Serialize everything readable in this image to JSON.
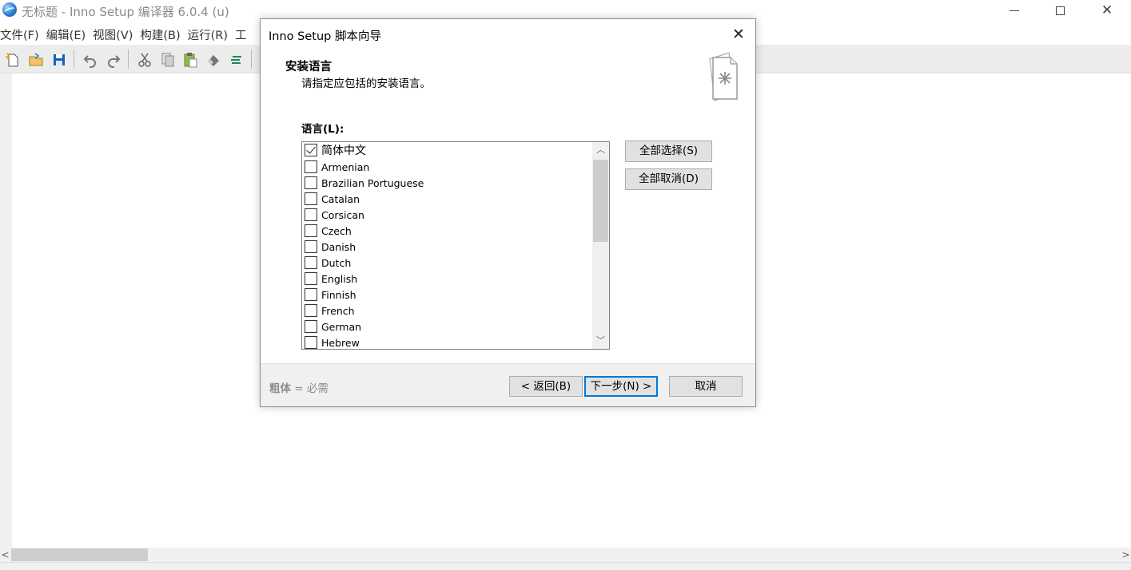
{
  "window": {
    "title": "无标题 - Inno Setup 编译器 6.0.4 (u)",
    "controls": {
      "minimize": "",
      "maximize": "",
      "close": "✕"
    }
  },
  "menu": {
    "items": [
      "文件(F)",
      "编辑(E)",
      "视图(V)",
      "构建(B)",
      "运行(R)",
      "工"
    ]
  },
  "toolbar": {
    "icons": [
      "new-file-icon",
      "open-file-icon",
      "save-icon",
      "undo-icon",
      "redo-icon",
      "cut-icon",
      "copy-icon",
      "paste-icon",
      "erase-icon",
      "format-icon"
    ]
  },
  "dialog": {
    "title": "Inno Setup 脚本向导",
    "close": "✕",
    "heading": "安装语言",
    "subheading": "请指定应包括的安装语言。",
    "languages_label": "语言(L):",
    "languages": [
      {
        "name": "简体中文",
        "checked": true
      },
      {
        "name": "Armenian",
        "checked": false
      },
      {
        "name": "Brazilian Portuguese",
        "checked": false
      },
      {
        "name": "Catalan",
        "checked": false
      },
      {
        "name": "Corsican",
        "checked": false
      },
      {
        "name": "Czech",
        "checked": false
      },
      {
        "name": "Danish",
        "checked": false
      },
      {
        "name": "Dutch",
        "checked": false
      },
      {
        "name": "English",
        "checked": false
      },
      {
        "name": "Finnish",
        "checked": false
      },
      {
        "name": "French",
        "checked": false
      },
      {
        "name": "German",
        "checked": false
      },
      {
        "name": "Hebrew",
        "checked": false
      }
    ],
    "scroll_up": "︿",
    "scroll_down": "﹀",
    "select_all_label": "全部选择(S)",
    "deselect_all_label": "全部取消(D)",
    "footer_note_bold": "粗体",
    "footer_note_rest": " = 必需",
    "back_label": "< 返回(B)",
    "next_label": "下一步(N) >",
    "cancel_label": "取消"
  },
  "scrollbar": {
    "left": "<",
    "right": ">"
  },
  "colors": {
    "accent": "#0078d7",
    "toolbar_bg": "#ececec",
    "button_bg": "#e1e1e1"
  }
}
